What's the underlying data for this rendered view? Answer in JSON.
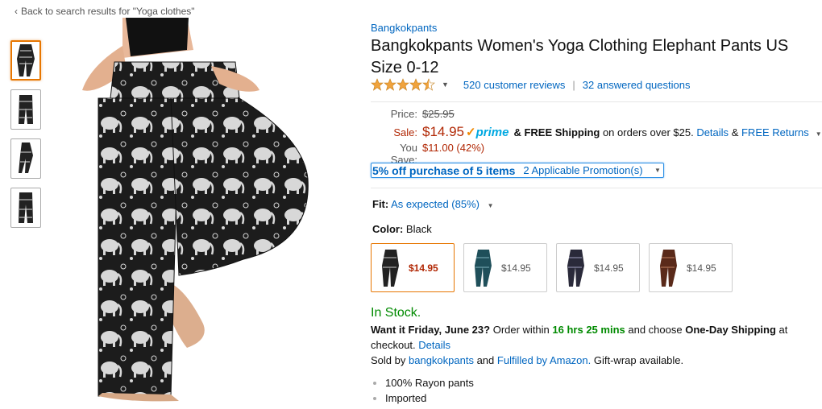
{
  "breadcrumb": {
    "back_label": "Back to search results for \"Yoga clothes\""
  },
  "thumbnails": [
    {
      "name": "thumb-1"
    },
    {
      "name": "thumb-2"
    },
    {
      "name": "thumb-3"
    },
    {
      "name": "thumb-4"
    }
  ],
  "product": {
    "brand": "Bangkokpants",
    "title": "Bangkokpants Women's Yoga Clothing Elephant Pants US Size 0-12",
    "rating": 4.5,
    "reviews_label": "520 customer reviews",
    "questions_label": "32 answered questions"
  },
  "pricing": {
    "price_label": "Price:",
    "list_price": "$25.95",
    "sale_label": "Sale:",
    "sale_price": "$14.95",
    "prime_label": "prime",
    "free_shipping": "& FREE Shipping",
    "shipping_suffix": "on orders over $25.",
    "details_link": "Details",
    "amp": "&",
    "free_returns": "FREE Returns",
    "you_save_label": "You Save:",
    "you_save_value": "$11.00 (42%)"
  },
  "promotion": {
    "offer": "5% off purchase of 5 items",
    "applicable": "2 Applicable Promotion(s)"
  },
  "fit": {
    "label": "Fit:",
    "value": "As expected (85%)"
  },
  "color": {
    "label": "Color:",
    "value": "Black"
  },
  "swatches": [
    {
      "price": "$14.95"
    },
    {
      "price": "$14.95"
    },
    {
      "price": "$14.95"
    },
    {
      "price": "$14.95"
    }
  ],
  "availability": {
    "stock": "In Stock.",
    "want_it": "Want it Friday, June 23?",
    "order_within": "Order within",
    "countdown": "16 hrs 25 mins",
    "and_choose": "and choose",
    "one_day": "One-Day Shipping",
    "at_checkout": "at checkout.",
    "details": "Details",
    "sold_by": "Sold by",
    "seller": "bangkokpants",
    "and": "and",
    "fulfilled": "Fulfilled by Amazon.",
    "gift": "Gift-wrap available."
  },
  "bullets": [
    "100% Rayon pants",
    "Imported"
  ],
  "colors": {
    "accent": "#0066c0",
    "sale": "#b12704",
    "stock": "#008a00",
    "selected_border": "#e77600",
    "prime": "#00a8e1"
  }
}
